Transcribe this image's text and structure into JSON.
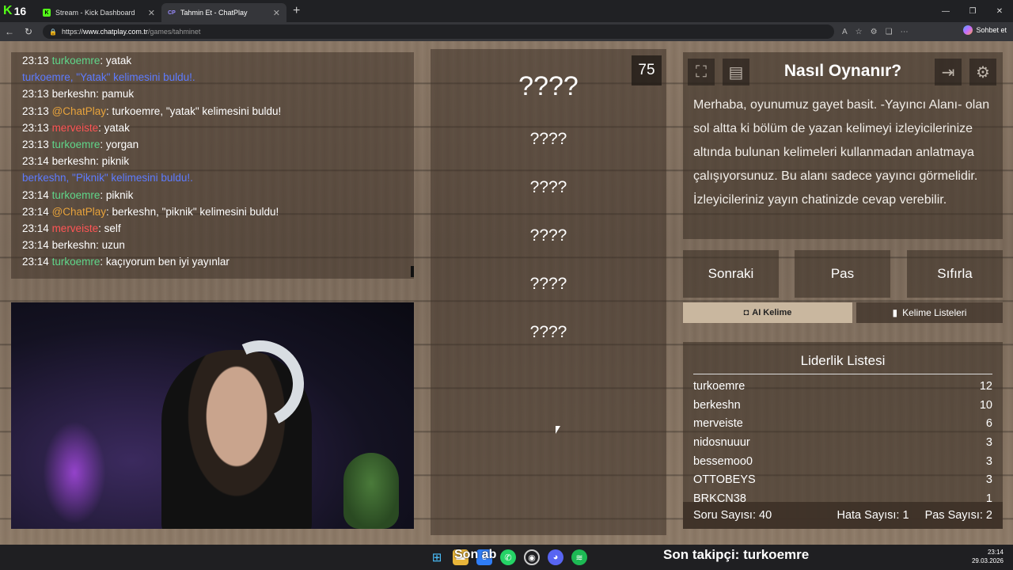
{
  "browser": {
    "tabs": [
      {
        "label": "Stream - Kick Dashboard",
        "icon": "kick-icon"
      },
      {
        "label": "Tahmin Et - ChatPlay",
        "icon": "chatplay-icon"
      }
    ],
    "kick_counter": "16",
    "url_prefix": "https://",
    "url_host": "www.chatplay.com.tr",
    "url_path": "/games/tahminet",
    "copilot_label": "Sohbet et"
  },
  "chat": {
    "messages": [
      {
        "time": "23:13",
        "user": "turkoemre",
        "text": ": yatak",
        "color": "green"
      },
      {
        "system": "turkoemre, \"Yatak\" kelimesini buldu!."
      },
      {
        "time": "23:13",
        "user": "berkeshn",
        "text": ": pamuk",
        "color": "white"
      },
      {
        "time": "23:13",
        "user": "@ChatPlay",
        "text": ": turkoemre, \"yatak\" kelimesini buldu!",
        "color": "orange"
      },
      {
        "time": "23:13",
        "user": "merveiste",
        "text": ": yatak",
        "color": "red"
      },
      {
        "time": "23:13",
        "user": "turkoemre",
        "text": ": yorgan",
        "color": "green"
      },
      {
        "time": "23:14",
        "user": "berkeshn",
        "text": ": piknik",
        "color": "white"
      },
      {
        "system": "berkeshn, \"Piknik\" kelimesini buldu!."
      },
      {
        "time": "23:14",
        "user": "turkoemre",
        "text": ": piknik",
        "color": "green"
      },
      {
        "time": "23:14",
        "user": "@ChatPlay",
        "text": ": berkeshn, \"piknik\" kelimesini buldu!",
        "color": "orange"
      },
      {
        "time": "23:14",
        "user": "merveiste",
        "text": ": self",
        "color": "red"
      },
      {
        "time": "23:14",
        "user": "berkeshn",
        "text": ": uzun",
        "color": "white"
      },
      {
        "time": "23:14",
        "user": "turkoemre",
        "text": ": kaçıyorum ben iyi yayınlar",
        "color": "green"
      }
    ]
  },
  "game": {
    "timer": "75",
    "main_word": "????",
    "forbidden_words": [
      "????",
      "????",
      "????",
      "????",
      "????"
    ]
  },
  "howto": {
    "title": "Nasıl Oynanır?",
    "text": "Merhaba, oyunumuz gayet basit. -Yayıncı Alanı- olan sol altta ki bölüm de yazan kelimeyi izleyicilerinize altında bulunan kelimeleri kullanmadan anlatmaya çalışıyorsunuz. Bu alanı sadece yayıncı görmelidir. İzleyicileriniz yayın chatinizde cevap verebilir."
  },
  "actions": {
    "next": "Sonraki",
    "pass": "Pas",
    "reset": "Sıfırla",
    "ai_word": "AI Kelime",
    "word_lists": "Kelime Listeleri"
  },
  "leaderboard": {
    "title": "Liderlik Listesi",
    "rows": [
      {
        "name": "turkoemre",
        "score": "12"
      },
      {
        "name": "berkeshn",
        "score": "10"
      },
      {
        "name": "merveiste",
        "score": "6"
      },
      {
        "name": "nidosnuuur",
        "score": "3"
      },
      {
        "name": "bessemoo0",
        "score": "3"
      },
      {
        "name": "OTTOBEYS",
        "score": "3"
      },
      {
        "name": "BRKCN38",
        "score": "1"
      }
    ],
    "question_count": "Soru Sayısı: 40",
    "error_count": "Hata Sayısı: 1",
    "pass_count": "Pas Sayısı: 2"
  },
  "overlay": {
    "partial_text": "Son ab",
    "last_follower": "Son takipçi: turkoemre"
  },
  "taskbar": {
    "time": "23:14",
    "date": "29.03.2026"
  },
  "colors": {
    "user_green": "#5fd68a",
    "user_red": "#ff5555",
    "user_orange": "#e8a33c",
    "system_blue": "#5d7bff"
  }
}
